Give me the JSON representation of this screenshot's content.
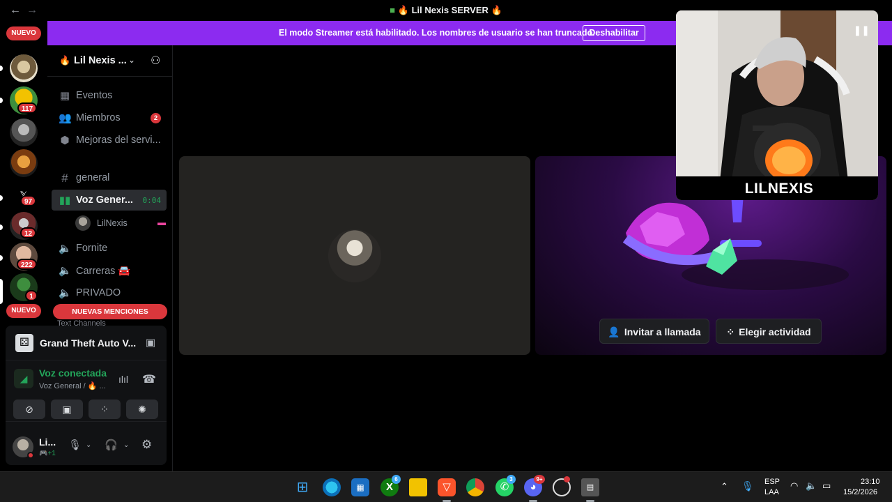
{
  "titlebar": {
    "title": "Lil Nexis SERVER",
    "back": "←",
    "forward": "→"
  },
  "banner": {
    "text": "El modo Streamer está habilitado. Los nombres de usuario se han truncado.",
    "button": "Deshabilitar"
  },
  "rail": {
    "new_top": "NUEVO",
    "new_bottom": "NUEVO",
    "badges": [
      "117",
      "97",
      "12",
      "222",
      "1"
    ]
  },
  "sidebar": {
    "server_name": "Lil Nexis ...",
    "items": [
      {
        "label": "Eventos",
        "icon": "calendar-icon"
      },
      {
        "label": "Miembros",
        "icon": "members-icon",
        "badge": "2"
      },
      {
        "label": "Mejoras del servi...",
        "icon": "boost-icon"
      },
      {
        "label": "general",
        "icon": "hash-icon"
      },
      {
        "label": "Voz Gener...",
        "icon": "voice-active-icon",
        "timer": "0:04"
      },
      {
        "label": "Fornite",
        "icon": "speaker-icon"
      },
      {
        "label": "Carreras 🚘",
        "icon": "speaker-icon"
      },
      {
        "label": "PRIVADO",
        "icon": "speaker-lock-icon"
      }
    ],
    "voice_user": "LilNexis",
    "mentions": "NUEVAS MENCIONES",
    "text_channels": "Text Channels"
  },
  "panel": {
    "activity": "Grand Theft Auto V...",
    "voice_status": "Voz conectada",
    "voice_sub": "Voz General / 🔥 ...",
    "username": "Li...",
    "user_sub": "🎮+1"
  },
  "tiles": {
    "invite": "Invitar a llamada",
    "activity": "Elegir actividad"
  },
  "cam": {
    "name": "LILNEXIS"
  },
  "taskbar": {
    "badges": {
      "xbox": "6",
      "whatsapp": "3",
      "discord": "9+"
    },
    "lang_top": "ESP",
    "lang_bottom": "LAA",
    "time": "23:10",
    "date": "15/2/2026"
  },
  "colors": {
    "accent": "#8c2bf0",
    "danger": "#da373c",
    "online": "#23a55a"
  }
}
